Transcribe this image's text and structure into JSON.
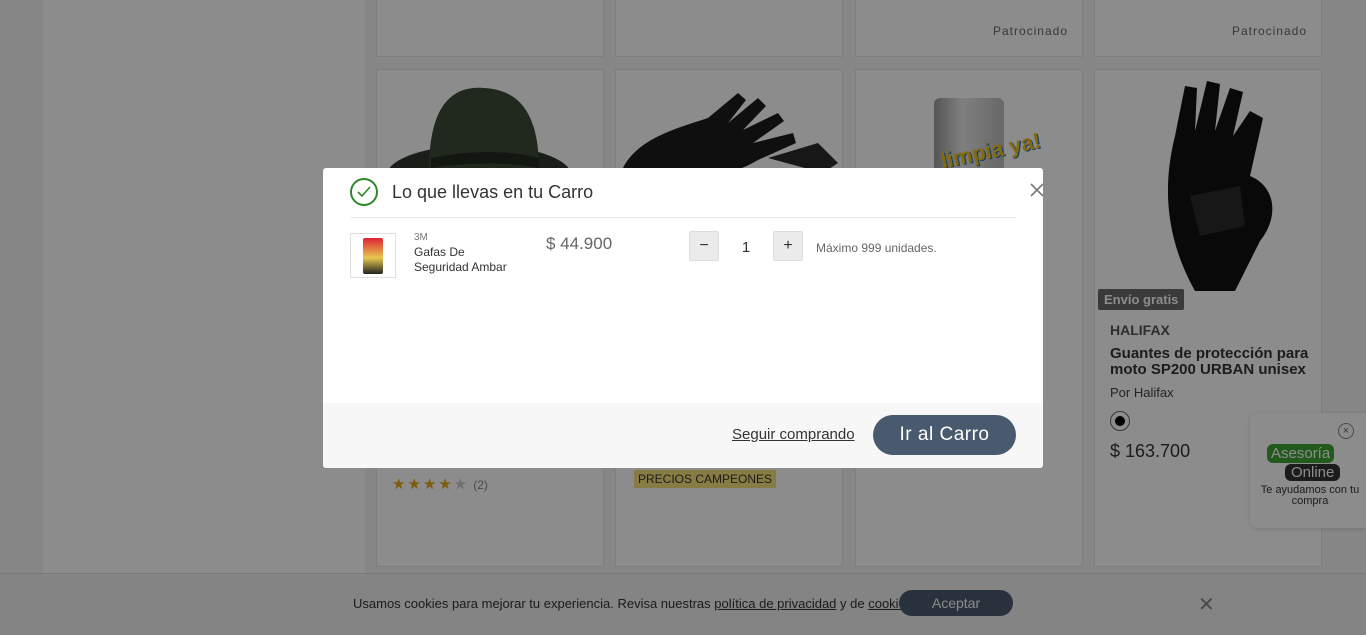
{
  "grid": {
    "sponsored_label": "Patrocinado",
    "products": [
      {
        "image": "hat",
        "rating_filled": 4,
        "rating_total": 5,
        "review_count": "(2)"
      },
      {
        "image": "black-gloves",
        "promo_tag": "PRECIOS CAMPEONES"
      },
      {
        "image": "cleaning-tube",
        "image_text": "limpia ya!"
      },
      {
        "image": "moto-glove",
        "badge": "Envío gratis",
        "brand": "HALIFAX",
        "title": "Guantes de protección para moto SP200 URBAN unisex",
        "seller": "Por Halifax",
        "price": "$ 163.700",
        "swatch_color": "#000000"
      }
    ]
  },
  "chat": {
    "line1": "Asesoría",
    "line2": "Online",
    "subtitle": "Te ayudamos con tu compra",
    "close_icon": "close-icon"
  },
  "cookies": {
    "text_before": "Usamos cookies para mejorar tu experiencia. Revisa nuestras ",
    "privacy_link": "política de privacidad",
    "text_middle": " y de ",
    "cookies_link": "cookies",
    "text_after": ".",
    "accept_label": "Aceptar",
    "close_icon": "close-icon"
  },
  "modal": {
    "title": "Lo que llevas en tu Carro",
    "success_icon": "check-circle-icon",
    "close_icon": "close-icon",
    "item": {
      "brand": "3M",
      "name": "Gafas De Seguridad Ambar",
      "price": "$ 44.900",
      "quantity": "1",
      "max_note": "Máximo 999 unidades.",
      "minus_label": "−",
      "plus_label": "+"
    },
    "footer": {
      "keep_shopping": "Seguir comprando",
      "go_to_cart": "Ir al Carro"
    }
  },
  "colors": {
    "primary_button": "#4a5a6e",
    "success": "#2c8a2c",
    "overlay": "rgba(0,0,0,0.45)"
  }
}
